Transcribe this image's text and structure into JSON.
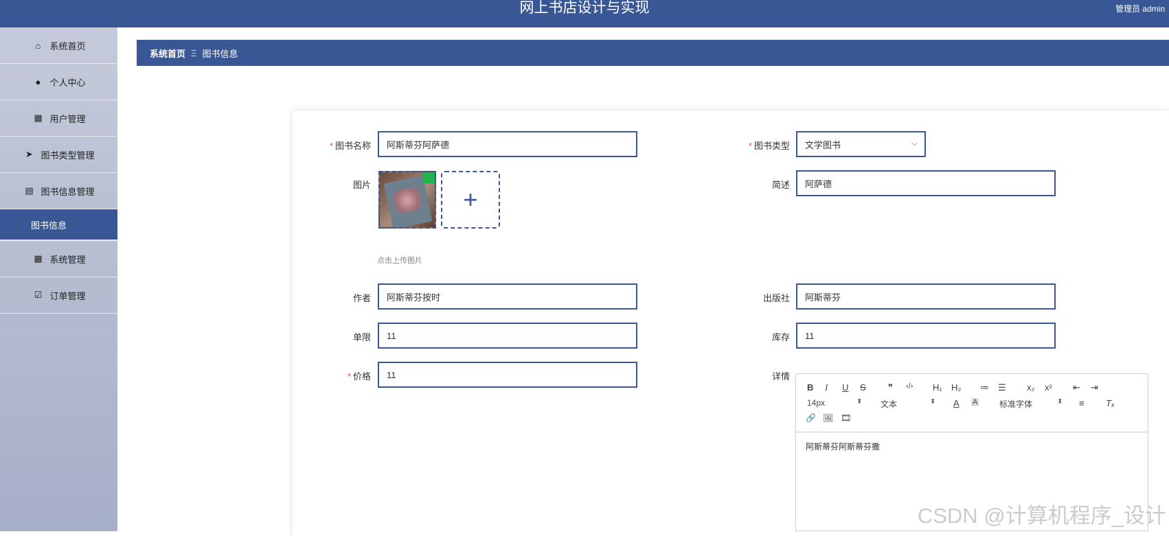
{
  "header": {
    "title": "网上书店设计与实现",
    "user": "管理员 admin"
  },
  "sidebar": {
    "items": [
      {
        "label": "系统首页",
        "icon": "home-icon"
      },
      {
        "label": "个人中心",
        "icon": "person-icon"
      },
      {
        "label": "用户管理",
        "icon": "grid-icon"
      },
      {
        "label": "图书类型管理",
        "icon": "send-icon"
      },
      {
        "label": "图书信息管理",
        "icon": "chart-icon"
      },
      {
        "label": "图书信息",
        "icon": ""
      },
      {
        "label": "系统管理",
        "icon": "grid-icon"
      },
      {
        "label": "订单管理",
        "icon": "clipboard-icon"
      }
    ]
  },
  "breadcrumb": {
    "home": "系统首页",
    "separator": "Ξ",
    "current": "图书信息"
  },
  "form": {
    "name_label": "图书名称",
    "name_value": "阿斯蒂芬阿萨德",
    "type_label": "图书类型",
    "type_value": "文学图书",
    "image_label": "图片",
    "upload_hint": "点击上传图片",
    "summary_label": "简述",
    "summary_value": "阿萨德",
    "author_label": "作者",
    "author_value": "阿斯蒂芬按时",
    "publisher_label": "出版社",
    "publisher_value": "阿斯蒂芬",
    "limit_label": "单限",
    "limit_value": "11",
    "stock_label": "库存",
    "stock_value": "11",
    "price_label": "价格",
    "price_value": "11",
    "detail_label": "详情",
    "required_mark": "*"
  },
  "editor": {
    "font_size": "14px",
    "text_style": "文本",
    "font_family": "标准字体",
    "buttons": {
      "bold": "B",
      "italic": "I",
      "underline": "U",
      "strike": "S",
      "quote": "❞",
      "code": "‹/›",
      "h1": "H₁",
      "h2": "H₂",
      "ordered_list": "≔",
      "bullet_list": "☰",
      "subscript": "x₂",
      "superscript": "x²",
      "outdent": "⇤",
      "indent": "⇥",
      "color": "A",
      "background": "A",
      "align": "≡",
      "clear": "Tₓ",
      "link": "🔗",
      "image": "🖼",
      "video": "🎞",
      "spinner": "⬍"
    },
    "content": "阿斯蒂芬阿斯蒂芬撒"
  },
  "watermark": "CSDN @计算机程序_设计"
}
